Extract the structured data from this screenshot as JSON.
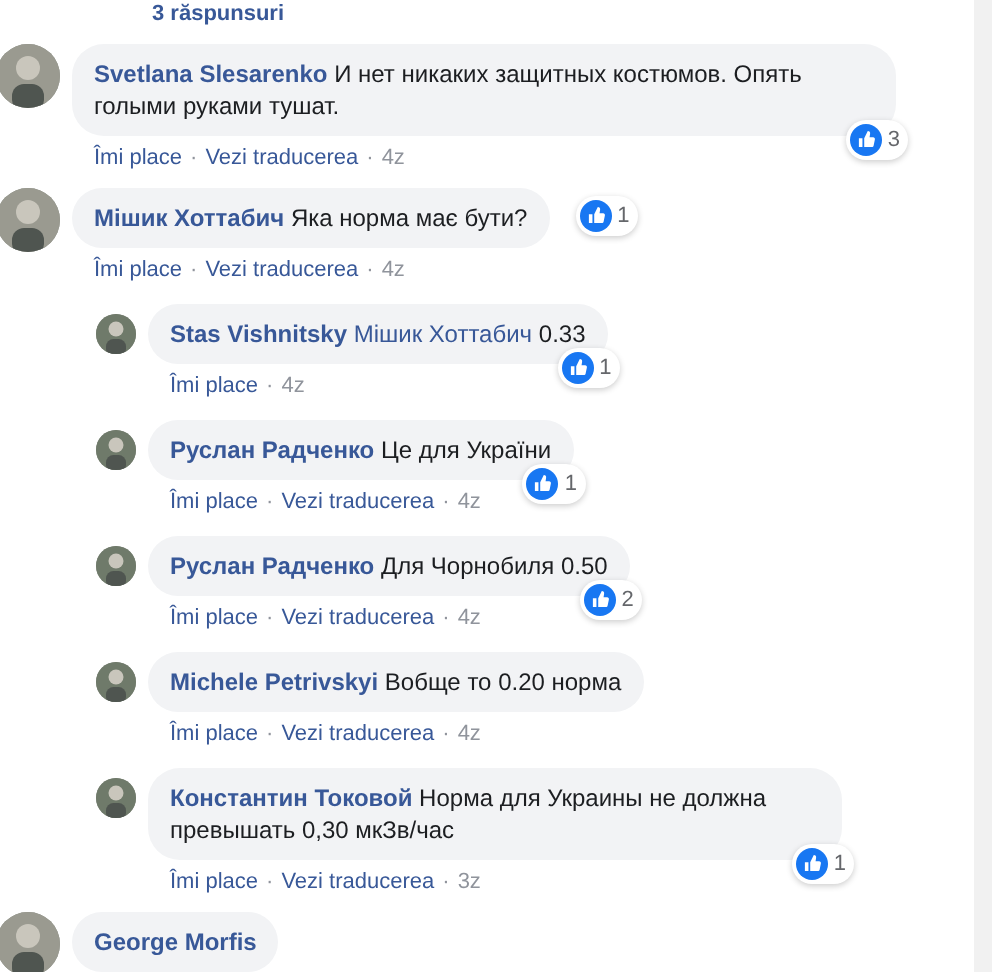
{
  "replies_link": {
    "label": "3 răspunsuri"
  },
  "separator": "·",
  "comments": [
    {
      "kind": "top",
      "author": "Svetlana Slesarenko",
      "text": "И нет никаких защитных костюмов. Опять голыми руками тушат.",
      "actions": [
        "Îmi place",
        "Vezi traducerea"
      ],
      "time": "4z",
      "likes": "3"
    },
    {
      "kind": "top",
      "author": "Мішик Хоттабич",
      "text": "Яка норма має бути?",
      "actions": [
        "Îmi place",
        "Vezi traducerea"
      ],
      "time": "4z",
      "likes": "1"
    },
    {
      "kind": "reply",
      "author": "Stas Vishnitsky",
      "mention": "Мішик Хоттабич",
      "text": "0.33",
      "actions": [
        "Îmi place"
      ],
      "time": "4z",
      "likes": "1"
    },
    {
      "kind": "reply",
      "author": "Руслан Радченко",
      "text": "Це для України",
      "actions": [
        "Îmi place",
        "Vezi traducerea"
      ],
      "time": "4z",
      "likes": "1"
    },
    {
      "kind": "reply",
      "author": "Руслан Радченко",
      "text": "Для Чорнобиля 0.50",
      "actions": [
        "Îmi place",
        "Vezi traducerea"
      ],
      "time": "4z",
      "likes": "2"
    },
    {
      "kind": "reply",
      "author": "Michele Petrivskyi",
      "text": "Вобще то 0.20 норма",
      "actions": [
        "Îmi place",
        "Vezi traducerea"
      ],
      "time": "4z"
    },
    {
      "kind": "reply",
      "author": "Константин Токовой",
      "text": "Норма для Украины не должна превышать 0,30 мкЗв/час",
      "actions": [
        "Îmi place",
        "Vezi traducerea"
      ],
      "time": "3z",
      "likes": "1"
    },
    {
      "kind": "top",
      "author": "George Morfis"
    }
  ]
}
